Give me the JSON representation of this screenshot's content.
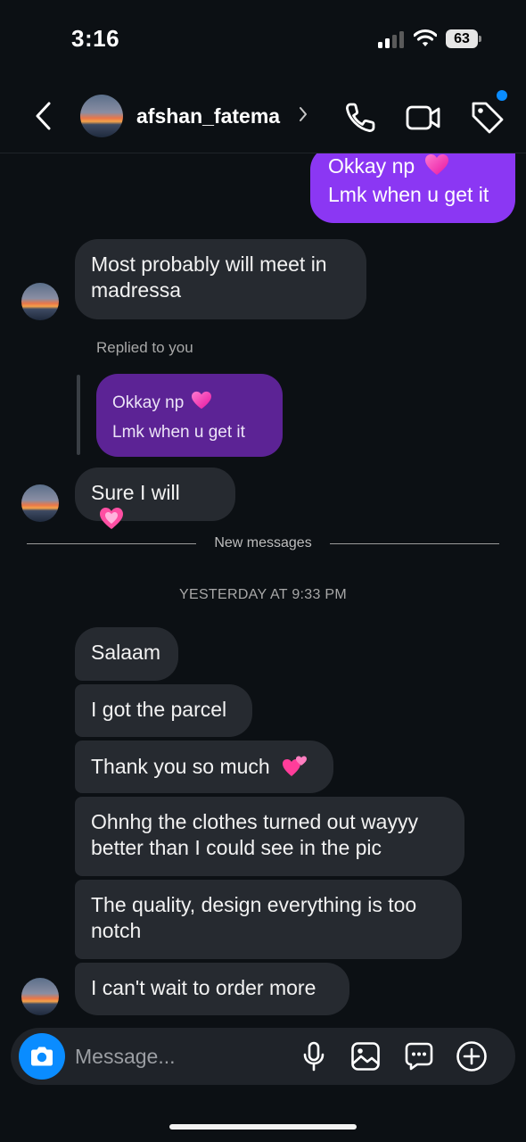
{
  "status_bar": {
    "time": "3:16",
    "battery": "63"
  },
  "header": {
    "username": "afshan_fatema",
    "chevron": "›"
  },
  "messages": {
    "sent_1": {
      "line1": "Okkay np",
      "line2": "Lmk when u get it"
    },
    "recv_1": "Most probably will meet in madressa",
    "replied_label": "Replied to you",
    "reply_quote": {
      "line1": "Okkay np",
      "line2": "Lmk when u get it"
    },
    "recv_2": "Sure I will",
    "new_messages_label": "New messages",
    "timestamp": "YESTERDAY AT 9:33 PM",
    "recv_3": "Salaam",
    "recv_4": "I got the parcel",
    "recv_5": "Thank you so much",
    "recv_6": "Ohnhg the clothes turned out wayyy better than I could see in the pic",
    "recv_7": "The quality, design everything is too notch",
    "recv_8": "I can't wait to order more"
  },
  "composer": {
    "placeholder": "Message..."
  },
  "icons": {
    "back": "chevron-left-icon",
    "call": "phone-icon",
    "video": "video-camera-icon",
    "tag": "tag-icon",
    "camera": "camera-icon",
    "mic": "microphone-icon",
    "gallery": "image-icon",
    "sticker": "chat-bubble-icon",
    "add": "plus-circle-icon"
  },
  "colors": {
    "background": "#0c1014",
    "sent_bubble": "#8b37f3",
    "received_bubble": "#262a30",
    "accent": "#0a8cff"
  }
}
